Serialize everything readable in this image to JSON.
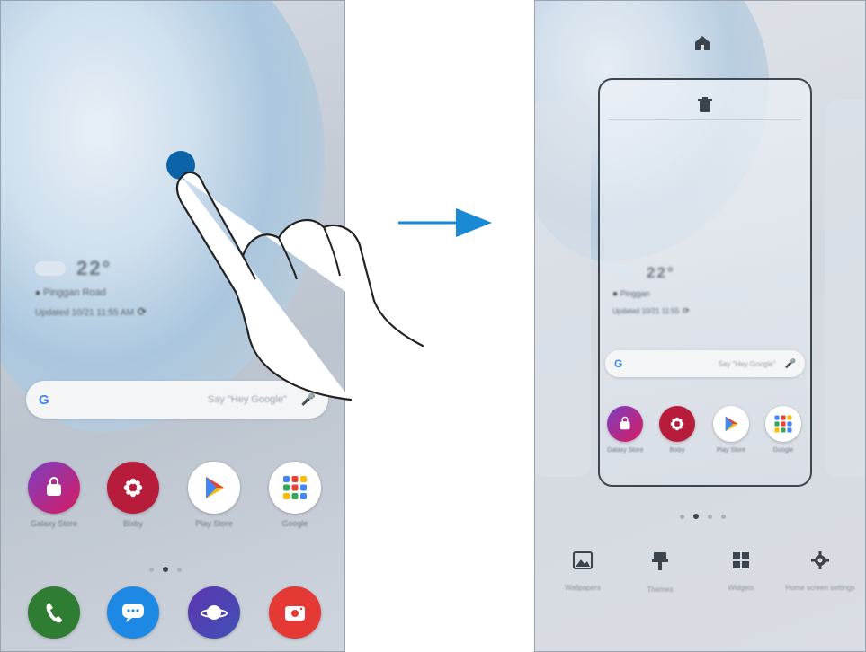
{
  "left_screen": {
    "weather": {
      "temp": "22°",
      "location": "Pinggan Road",
      "updated": "Updated 10/21 11:55 AM"
    },
    "search": {
      "logo": "G",
      "hint": "Say \"Hey Google\""
    },
    "apps_row1": [
      {
        "name": "Galaxy Store",
        "icon": "shopping-bag-icon",
        "color": "#c2185b"
      },
      {
        "name": "Bixby",
        "icon": "flower-icon",
        "color": "#b71c3b"
      },
      {
        "name": "Play Store",
        "icon": "play-triangle-icon",
        "color": "#ffffff"
      },
      {
        "name": "Google",
        "icon": "app-grid-icon",
        "color": "#ffffff"
      }
    ],
    "dock": [
      {
        "name": "Phone",
        "icon": "phone-icon",
        "color": "#2e7d32"
      },
      {
        "name": "Messages",
        "icon": "message-icon",
        "color": "#1976d2"
      },
      {
        "name": "Internet",
        "icon": "planet-icon",
        "color": "#5c6bc0"
      },
      {
        "name": "Camera",
        "icon": "camera-icon",
        "color": "#e53935"
      }
    ]
  },
  "right_screen": {
    "weather": {
      "temp": "22°",
      "location": "Pinggan",
      "updated": "Updated 10/21 11:55"
    },
    "search": {
      "logo": "G",
      "hint": "Say \"Hey Google\""
    },
    "apps": [
      {
        "name": "Galaxy Store",
        "icon": "shopping-bag-icon",
        "color": "#c2185b"
      },
      {
        "name": "Bixby",
        "icon": "flower-icon",
        "color": "#b71c3b"
      },
      {
        "name": "Play Store",
        "icon": "play-triangle-icon",
        "color": "#ffffff"
      },
      {
        "name": "Google",
        "icon": "app-grid-icon",
        "color": "#ffffff"
      }
    ],
    "tools": [
      {
        "label": "Wallpapers",
        "icon": "image-icon"
      },
      {
        "label": "Themes",
        "icon": "brush-icon"
      },
      {
        "label": "Widgets",
        "icon": "widgets-icon"
      },
      {
        "label": "Home screen settings",
        "icon": "gear-icon"
      }
    ]
  },
  "colors": {
    "arrow": "#1a8ad6",
    "touch": "#0d63a8"
  }
}
